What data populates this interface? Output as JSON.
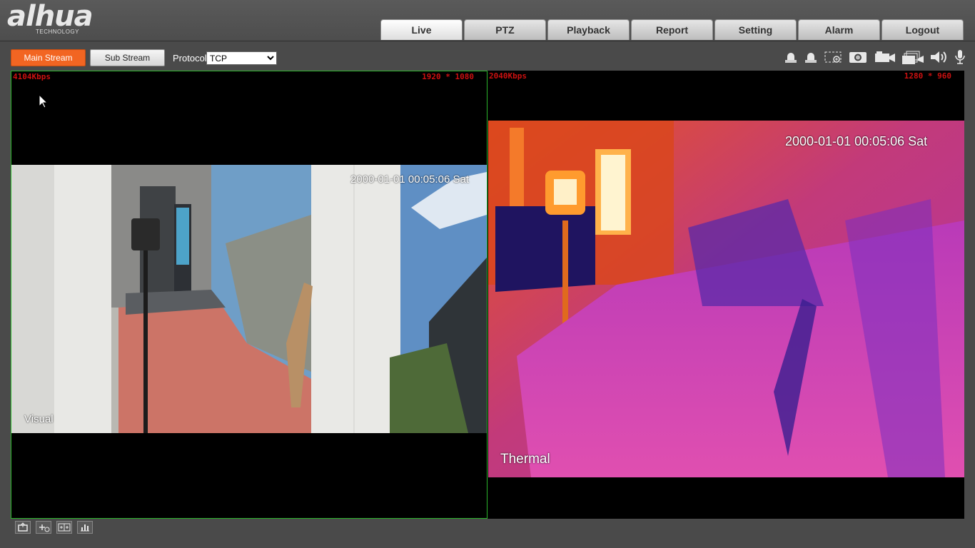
{
  "header": {
    "logo_text": "alhua",
    "logo_tagline": "TECHNOLOGY",
    "nav": [
      {
        "label": "Live",
        "active": true
      },
      {
        "label": "PTZ",
        "active": false
      },
      {
        "label": "Playback",
        "active": false
      },
      {
        "label": "Report",
        "active": false
      },
      {
        "label": "Setting",
        "active": false
      },
      {
        "label": "Alarm",
        "active": false
      },
      {
        "label": "Logout",
        "active": false
      }
    ]
  },
  "toolbar": {
    "main_stream_label": "Main Stream",
    "sub_stream_label": "Sub Stream",
    "protocol_label": "Protocol",
    "protocol_value": "TCP",
    "tool_icons": [
      "alarm-out-1-icon",
      "alarm-out-2-icon",
      "digital-zoom-icon",
      "snapshot-icon",
      "record-icon",
      "triple-snapshot-icon",
      "audio-icon",
      "microphone-icon"
    ]
  },
  "video": {
    "left": {
      "bitrate": "4104Kbps",
      "resolution": "1920 * 1080",
      "timestamp": "2000-01-01 00:05:06 Sat",
      "channel_name": "Visual"
    },
    "right": {
      "bitrate": "2040Kbps",
      "resolution": "1280 * 960",
      "timestamp": "2000-01-01 00:05:06 Sat",
      "channel_name": "Thermal"
    }
  },
  "bottom_icons": [
    "original-size-icon",
    "ptz-control-icon",
    "window-layout-icon",
    "stream-statistics-icon"
  ],
  "colors": {
    "accent": "#f26522",
    "selection_border": "#2bb52b",
    "osd_text": "#cc1010"
  }
}
